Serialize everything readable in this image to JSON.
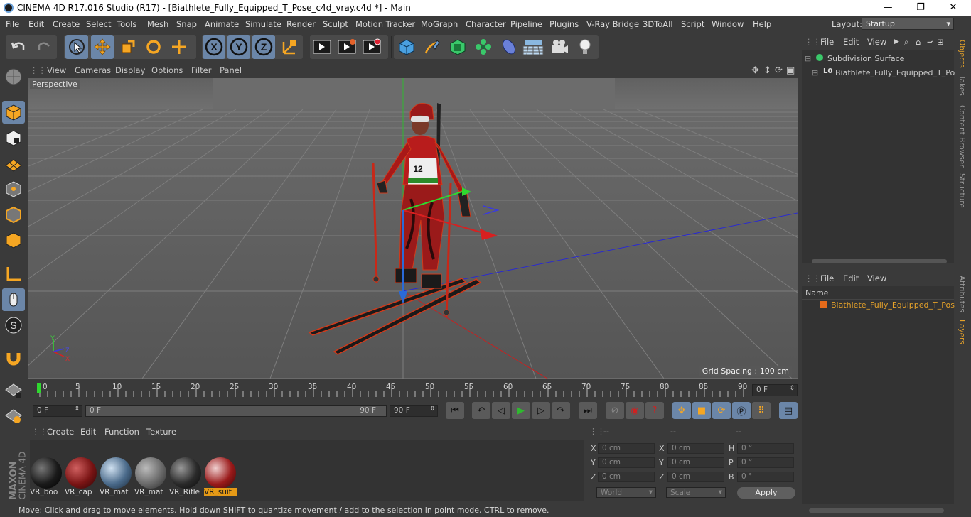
{
  "titlebar": {
    "title": "CINEMA 4D R17.016 Studio (R17) - [Biathlete_Fully_Equipped_T_Pose_c4d_vray.c4d *] - Main",
    "minimize": "—",
    "maximize": "❐",
    "close": "✕"
  },
  "menu": [
    "File",
    "Edit",
    "Create",
    "Select",
    "Tools",
    "Mesh",
    "Snap",
    "Animate",
    "Simulate",
    "Render",
    "Sculpt",
    "Motion Tracker",
    "MoGraph",
    "Character",
    "Pipeline",
    "Plugins",
    "V-Ray Bridge",
    "3DToAll",
    "Script",
    "Window",
    "Help"
  ],
  "layout": {
    "label": "Layout:",
    "value": "Startup"
  },
  "viewport": {
    "menu": [
      "View",
      "Cameras",
      "Display",
      "Options",
      "Filter",
      "Panel"
    ],
    "camera": "Perspective",
    "grid_spacing": "Grid Spacing : 100 cm",
    "bib_number": "12",
    "axis_y": "Y",
    "axis_z": "Z",
    "axis_x": "X"
  },
  "timeline": {
    "ticks": [
      "0",
      "5",
      "10",
      "15",
      "20",
      "25",
      "30",
      "35",
      "40",
      "45",
      "50",
      "55",
      "60",
      "65",
      "70",
      "75",
      "80",
      "85",
      "90"
    ],
    "current_frame": "0 F",
    "start_frame": "0 F",
    "slider_start": "0 F",
    "slider_end": "90 F",
    "end_frame": "90 F"
  },
  "material_manager": {
    "menu": [
      "Create",
      "Edit",
      "Function",
      "Texture"
    ],
    "materials": [
      {
        "name": "VR_boo",
        "color": "#1a1a1a"
      },
      {
        "name": "VR_cap",
        "color": "#7a1414"
      },
      {
        "name": "VR_mat",
        "color": "#4a6a8a"
      },
      {
        "name": "VR_mat",
        "color": "#6a6a6a"
      },
      {
        "name": "VR_Rifle",
        "color": "#2a2a2a"
      },
      {
        "name": "VR_suit",
        "color": "#9a1a1a"
      }
    ]
  },
  "coordinates": {
    "headers": [
      "--",
      "--",
      "--"
    ],
    "rows": [
      {
        "a_lbl": "X",
        "a": "0 cm",
        "b_lbl": "X",
        "b": "0 cm",
        "c_lbl": "H",
        "c": "0 °"
      },
      {
        "a_lbl": "Y",
        "a": "0 cm",
        "b_lbl": "Y",
        "b": "0 cm",
        "c_lbl": "P",
        "c": "0 °"
      },
      {
        "a_lbl": "Z",
        "a": "0 cm",
        "b_lbl": "Z",
        "b": "0 cm",
        "c_lbl": "B",
        "c": "0 °"
      }
    ],
    "mode1": "World",
    "mode2": "Scale",
    "apply": "Apply"
  },
  "objects_panel": {
    "menu": [
      "File",
      "Edit",
      "View"
    ],
    "items": [
      "Subdivision Surface",
      "Biathlete_Fully_Equipped_T_Pose"
    ]
  },
  "layers_panel": {
    "menu": [
      "File",
      "Edit",
      "View"
    ],
    "column": "Name",
    "items": [
      "Biathlete_Fully_Equipped_T_Pose"
    ]
  },
  "side_tabs": [
    "Objects",
    "Takes",
    "Content Browser",
    "Structure",
    "Attributes",
    "Layers"
  ],
  "status": "Move: Click and drag to move elements. Hold down SHIFT to quantize movement / add to the selection in point mode, CTRL to remove.",
  "brand": {
    "line1": "MAXON",
    "line2": "CINEMA 4D"
  }
}
